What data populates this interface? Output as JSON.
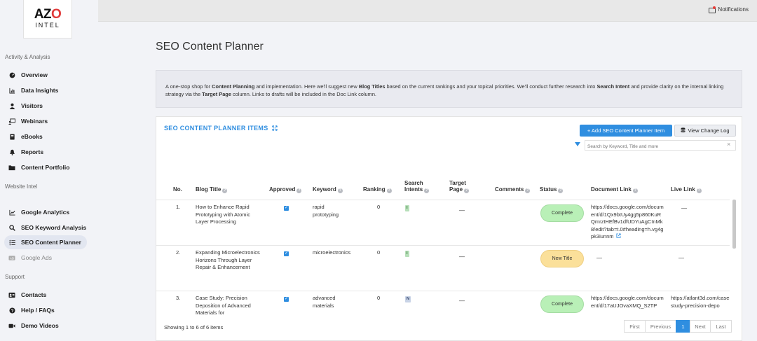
{
  "topbar": {
    "notifications_label": "Notifications"
  },
  "logo": {
    "line1_a": "AZ",
    "line1_b": "O",
    "line2": "INTEL"
  },
  "sidebar": {
    "sections": [
      {
        "label": "Activity & Analysis"
      },
      {
        "label": "Website Intel"
      },
      {
        "label": "Support"
      }
    ],
    "items": [
      {
        "label": "Overview",
        "icon": "dashboard-icon"
      },
      {
        "label": "Data Insights",
        "icon": "bar-chart-icon"
      },
      {
        "label": "Visitors",
        "icon": "user-icon"
      },
      {
        "label": "Webinars",
        "icon": "webinar-icon"
      },
      {
        "label": "eBooks",
        "icon": "book-icon"
      },
      {
        "label": "Reports",
        "icon": "bell-icon"
      },
      {
        "label": "Content Portfolio",
        "icon": "folder-icon"
      },
      {
        "label": "Google Analytics",
        "icon": "line-chart-icon"
      },
      {
        "label": "SEO Keyword Analysis",
        "icon": "search-icon"
      },
      {
        "label": "SEO Content Planner",
        "icon": "list-icon"
      },
      {
        "label": "Google Ads",
        "icon": "ads-icon"
      },
      {
        "label": "Contacts",
        "icon": "contacts-icon"
      },
      {
        "label": "Help / FAQs",
        "icon": "help-icon"
      },
      {
        "label": "Demo Videos",
        "icon": "video-icon"
      }
    ]
  },
  "main": {
    "title": "SEO Content Planner",
    "intro": {
      "p1": "A one-stop shop for ",
      "b1": "Content Planning",
      "p2": " and implementation. Here we'll suggest new ",
      "b2": "Blog Titles",
      "p3": " based on the current rankings and your topical priorities. We'll conduct further research into ",
      "b3": "Search Intent",
      "p4": " and provide clarity on the internal linking strategy via the ",
      "b4": "Target Page",
      "p5": " column. Links to drafts will be included in the Doc Link column."
    },
    "card": {
      "title": "SEO CONTENT PLANNER ITEMS",
      "add_button": "+ Add SEO Content Planner Item",
      "log_button": "View Change Log",
      "search_placeholder": "Search by Keyword, Title and more"
    },
    "table": {
      "headers": {
        "no": "No.",
        "blog_title": "Blog Title",
        "approved": "Approved",
        "keyword": "Keyword",
        "ranking": "Ranking",
        "search_intents_1": "Search",
        "search_intents_2": "Intents",
        "target_page_1": "Target",
        "target_page_2": "Page",
        "comments": "Comments",
        "status": "Status",
        "document_link": "Document Link",
        "live_link": "Live Link"
      },
      "rows": [
        {
          "no": "1.",
          "title": "How to Enhance Rapid Prototyping with Atomic Layer Processing",
          "approved": true,
          "keyword": "rapid prototyping",
          "ranking": "0",
          "intent": "I",
          "target": "—",
          "status": "Complete",
          "doc": "https://docs.google.com/document/d/1Qx9btUy4gg5p860KuRQmrztHEfBv1dfUDYuAgCInMk8/edit?tab=t.0#heading=h.vg4gpk3iunnm",
          "live": "—"
        },
        {
          "no": "2.",
          "title": "Expanding Microelectronics Horizons Through Layer Repair & Enhancement",
          "approved": true,
          "keyword": "microelectronics",
          "ranking": "0",
          "intent": "I",
          "target": "—",
          "status": "New Title",
          "doc": "—",
          "live": "—"
        },
        {
          "no": "3.",
          "title": "Case Study: Precision Deposition of Advanced Materials for",
          "approved": true,
          "keyword": "advanced materials",
          "ranking": "0",
          "intent": "N",
          "target": "—",
          "status": "Complete",
          "doc": "https://docs.google.com/document/d/17aUJOvaXMQ_S2TP",
          "live": "https://atlant3d.com/case-study-precision-depo"
        }
      ]
    },
    "footer": {
      "showing": "Showing 1 to 6 of 6 items",
      "pager": {
        "first": "First",
        "previous": "Previous",
        "current": "1",
        "next": "Next",
        "last": "Last"
      }
    }
  }
}
